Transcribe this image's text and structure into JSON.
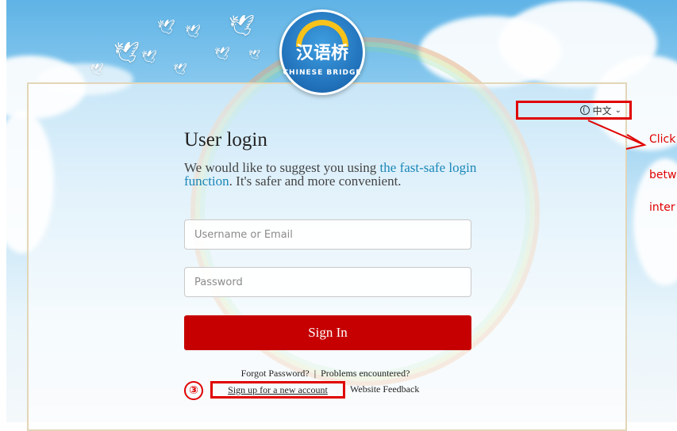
{
  "logo": {
    "title": "汉语桥",
    "subtitle": "CHINESE BRIDGE"
  },
  "language": {
    "current": "中文",
    "icon": "globe-icon",
    "dropdown_icon": "chevron-down-icon"
  },
  "annotation": {
    "lines": [
      "Click",
      "betw",
      "inter"
    ],
    "step_marker": "③",
    "color": "#e00000"
  },
  "login": {
    "title": "User login",
    "description_prefix": "We would like to suggest you using ",
    "description_link": "the fast-safe login function",
    "description_suffix": ". It's safer and more convenient.",
    "username_placeholder": "Username or Email",
    "password_placeholder": "Password",
    "sign_in_label": "Sign In",
    "forgot_password": "Forgot Password?",
    "separator": "|",
    "problems": "Problems encountered?",
    "signup": "Sign up for a new account",
    "feedback": "Website Feedback"
  },
  "colors": {
    "primary_button": "#c60000",
    "link": "#1a86b8",
    "highlight": "#e00000"
  }
}
